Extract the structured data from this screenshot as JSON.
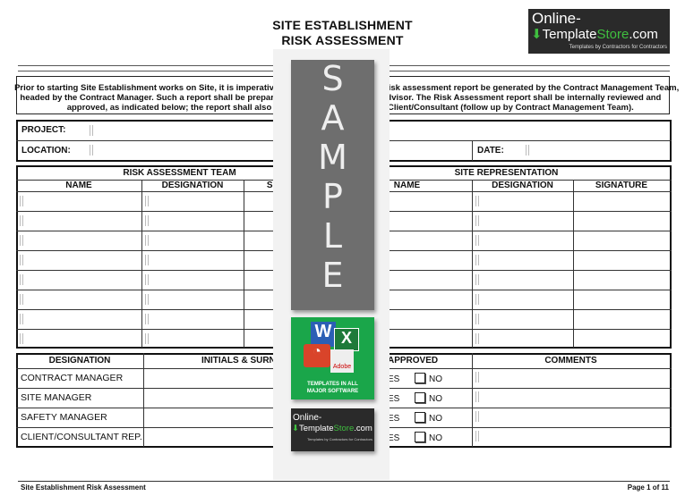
{
  "header": {
    "title_line1": "SITE ESTABLISHMENT",
    "title_line2": "RISK ASSESSMENT"
  },
  "logo": {
    "line1": "Online-",
    "line2_a": "T",
    "line2_b": "emplate",
    "line2_c": "Store",
    ".com": ".com",
    "tagline": "Templates by Contractors for Contractors",
    "dot_com": ".com"
  },
  "intro": {
    "left": [
      "Prior to starting Site Establishment works on Site, it is imperative t",
      "headed by the Contract Manager. Such a report shall be prepared",
      "approved, as indicated below; the report shall also be"
    ],
    "right": [
      "risk assessment report be generated by the Contract Management Team,",
      "y Advisor. The Risk Assessment report shall be internally reviewed and",
      "Client/Consultant (follow up by Contract Management Team)."
    ]
  },
  "project": {
    "project_label": "PROJECT:",
    "location_label": "LOCATION:",
    "date_label": "DATE:"
  },
  "team": {
    "left_title": "RISK ASSESSMENT TEAM",
    "right_title": "SITE REPRESENTATION",
    "name": "NAME",
    "designation": "DESIGNATION",
    "signature": "SIGNATURE",
    "row_count": 8
  },
  "approval": {
    "col_designation": "DESIGNATION",
    "col_initials": "INITIALS & SURN",
    "col_approved": "APPROVED",
    "col_comments": "COMMENTS",
    "rows": [
      {
        "designation": "CONTRACT MANAGER"
      },
      {
        "designation": "SITE MANAGER"
      },
      {
        "designation": "SAFETY MANAGER"
      },
      {
        "designation": "CLIENT/CONSULTANT REP."
      }
    ],
    "yes_fragment": "ES",
    "no_label": "NO"
  },
  "watermark": {
    "letters": [
      "S",
      "A",
      "M",
      "P",
      "L",
      "E"
    ],
    "software_line1": "TEMPLATES IN ALL",
    "software_line2": "MAJOR SOFTWARE",
    "adobe": "Adobe"
  },
  "footer": {
    "left": "Site Establishment Risk Assessment",
    "right": "Page 1 of 11"
  },
  "colors": {
    "logo_bg": "#2a2a2a",
    "logo_green": "#3fbf3f",
    "watermark_gray": "#6e6e6e",
    "software_green": "#1aa64a"
  }
}
